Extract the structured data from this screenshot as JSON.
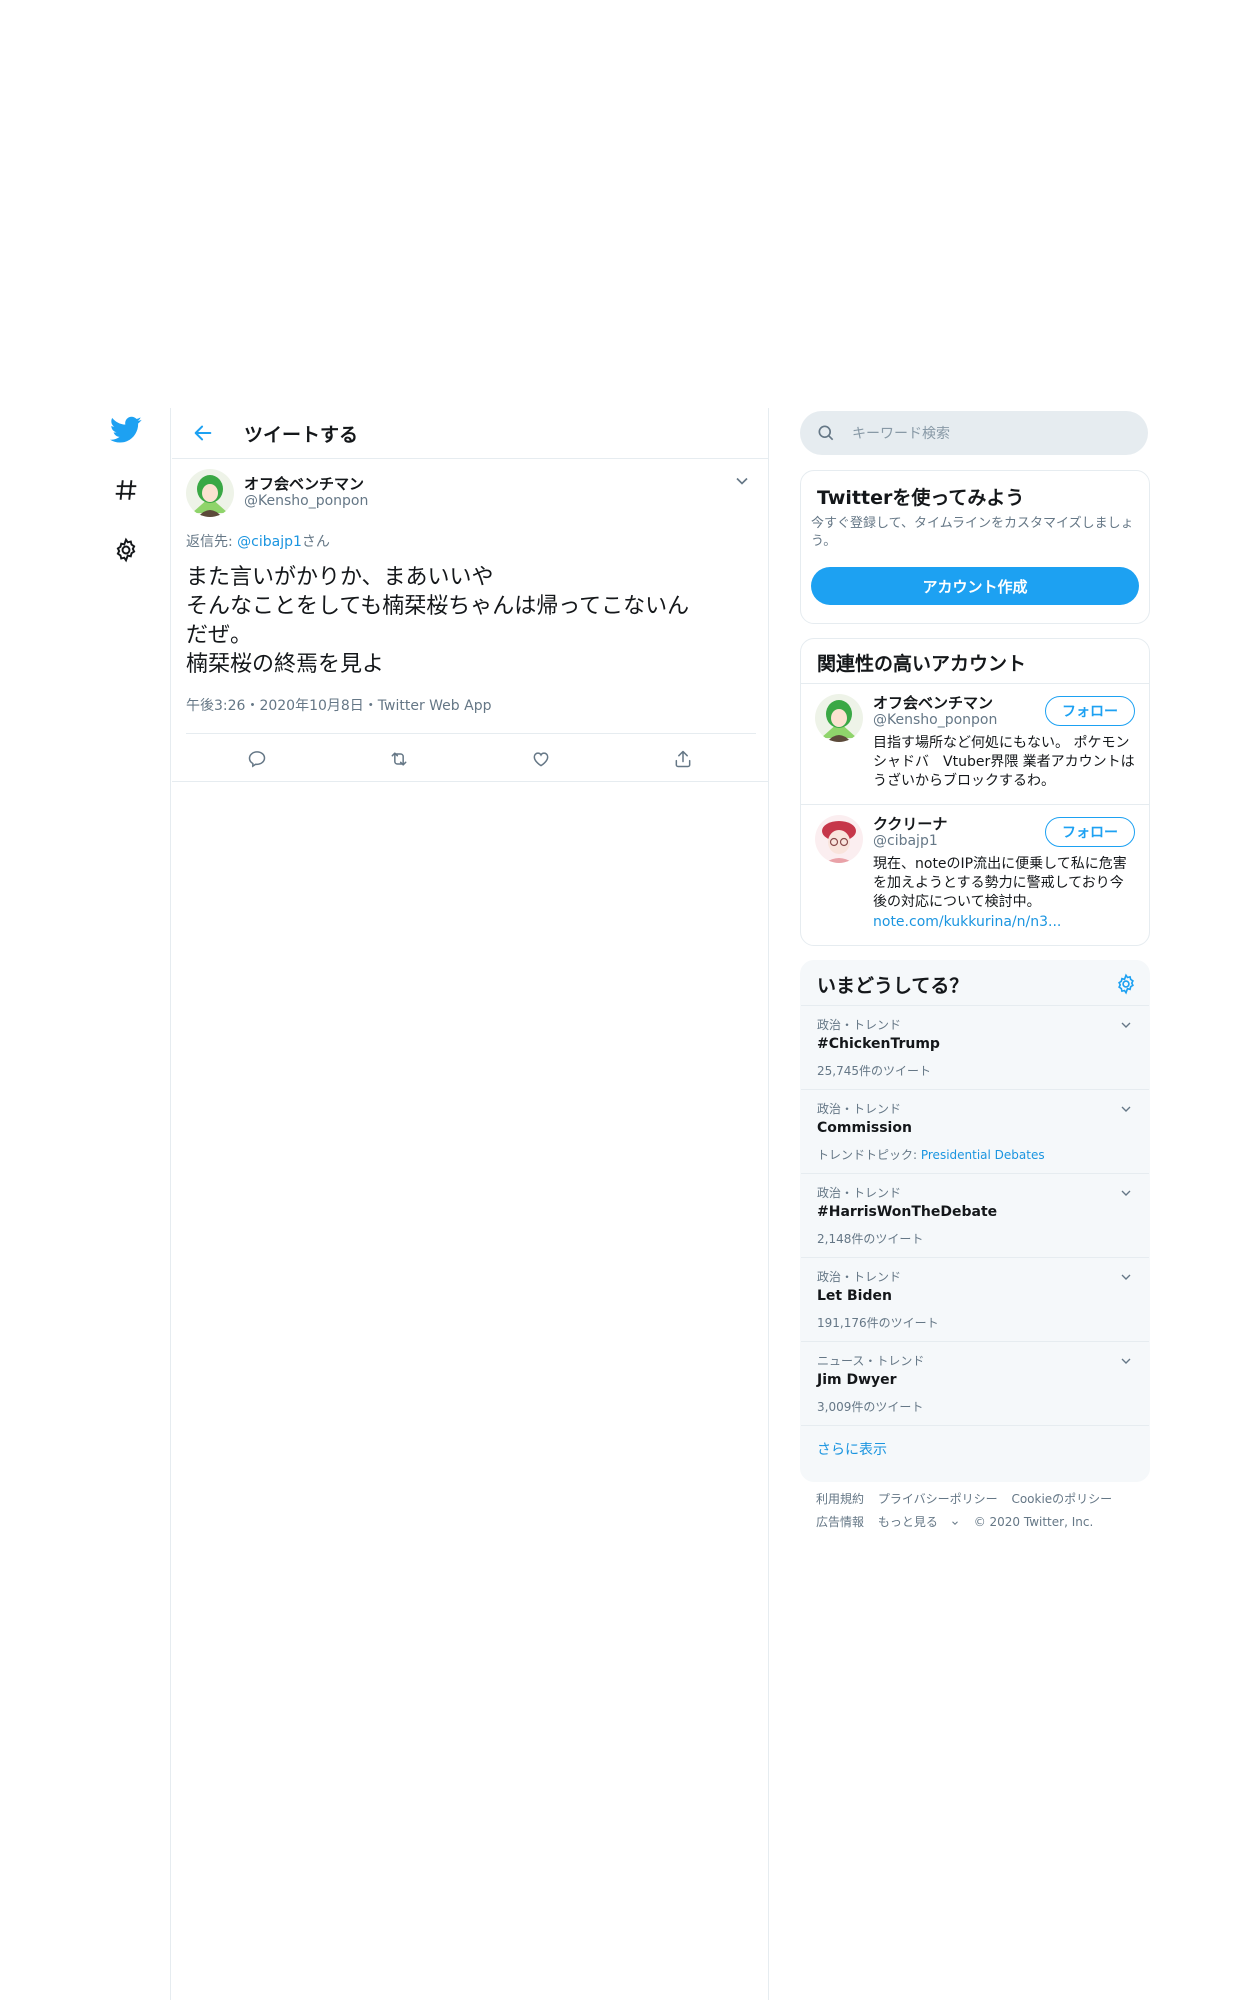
{
  "colors": {
    "accent": "#1da1f2",
    "text": "#14171a",
    "muted": "#657786",
    "border": "#e6ecf0",
    "panel": "#f5f8fa"
  },
  "header": {
    "title": "ツイートする"
  },
  "tweet": {
    "author_name": "オフ会ベンチマン",
    "author_handle": "@Kensho_ponpon",
    "reply_prefix": "返信先: ",
    "reply_handle": "@cibajp1",
    "reply_suffix": "さん",
    "text": "また言いがかりか、まあいいや\nそんなことをしても楠栞桜ちゃんは帰ってこないん\nだぜ。\n楠栞桜の終焉を見よ",
    "meta": "午後3:26・2020年10月8日・Twitter Web App"
  },
  "search": {
    "placeholder": "キーワード検索"
  },
  "signup": {
    "title": "Twitterを使ってみよう",
    "description": "今すぐ登録して、タイムラインをカスタマイズしましょう。",
    "button": "アカウント作成"
  },
  "related": {
    "title": "関連性の高いアカウント",
    "accounts": [
      {
        "name": "オフ会ベンチマン",
        "handle": "@Kensho_ponpon",
        "follow": "フォロー",
        "bio": "目指す場所など何処にもない。 ポケモン　シャドバ　Vtuber界隈 業者アカウントはうざいからブロックするわ。"
      },
      {
        "name": "ククリーナ",
        "handle": "@cibajp1",
        "follow": "フォロー",
        "bio": "現在、noteのIP流出に便乗して私に危害を加えようとする勢力に警戒しており今後の対応について検討中。",
        "link": "note.com/kukkurina/n/n3..."
      }
    ]
  },
  "trends": {
    "title": "いまどうしてる？",
    "items": [
      {
        "category": "政治・トレンド",
        "name": "#ChickenTrump",
        "count": "25,745件のツイート"
      },
      {
        "category": "政治・トレンド",
        "name": "Commission",
        "topic_prefix": "トレンドトピック: ",
        "topic": "Presidential Debates"
      },
      {
        "category": "政治・トレンド",
        "name": "#HarrisWonTheDebate",
        "count": "2,148件のツイート"
      },
      {
        "category": "政治・トレンド",
        "name": "Let Biden",
        "count": "191,176件のツイート"
      },
      {
        "category": "ニュース・トレンド",
        "name": "Jim Dwyer",
        "count": "3,009件のツイート"
      }
    ],
    "show_more": "さらに表示"
  },
  "footer": {
    "row1": [
      "利用規約",
      "プライバシーポリシー",
      "Cookieのポリシー"
    ],
    "row2": [
      "広告情報",
      "もっと見る"
    ],
    "copyright": "© 2020 Twitter, Inc."
  }
}
